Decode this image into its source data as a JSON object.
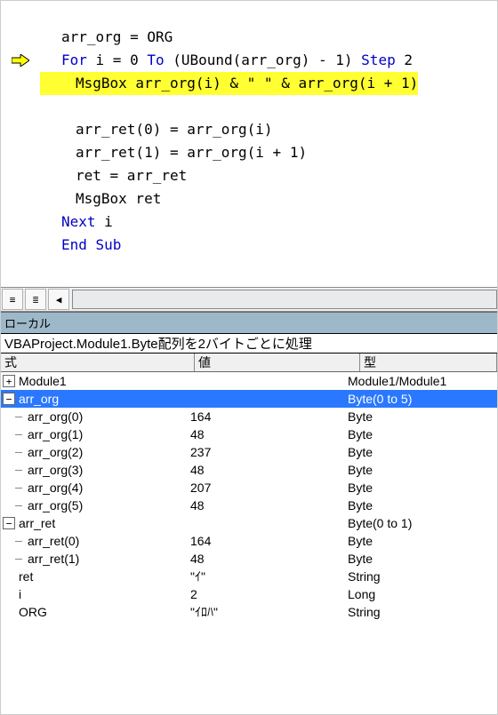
{
  "code": {
    "l1": "arr_org = ORG",
    "l2a": "For",
    "l2b": " i = 0 ",
    "l2c": "To",
    "l2d": " (UBound(arr_org) - 1) ",
    "l2e": "Step",
    "l2f": " 2",
    "l3": "MsgBox arr_org(i) & \" \" & arr_org(i + 1)",
    "l4": "",
    "l5": "arr_ret(0) = arr_org(i)",
    "l6": "arr_ret(1) = arr_org(i + 1)",
    "l7": "ret = arr_ret",
    "l8": "MsgBox ret",
    "l9a": "Next",
    "l9b": " i",
    "l10": "End Sub"
  },
  "toolbar": {
    "btn1": "≡",
    "btn2": "≣",
    "btn3": "◀"
  },
  "panel": {
    "title": "ローカル",
    "context": "VBAProject.Module1.Byte配列を2バイトごとに処理",
    "headers": {
      "c1": "式",
      "c2": "値",
      "c3": "型"
    },
    "rows": [
      {
        "toggle": "plus",
        "depth": 0,
        "name": "Module1",
        "value": "",
        "type": "Module1/Module1",
        "sel": false
      },
      {
        "toggle": "minus",
        "depth": 0,
        "name": "arr_org",
        "value": "",
        "type": "Byte(0 to 5)",
        "sel": true
      },
      {
        "toggle": "",
        "depth": 1,
        "name": "arr_org(0)",
        "value": "164",
        "type": "Byte",
        "branch": "mid"
      },
      {
        "toggle": "",
        "depth": 1,
        "name": "arr_org(1)",
        "value": "48",
        "type": "Byte",
        "branch": "mid"
      },
      {
        "toggle": "",
        "depth": 1,
        "name": "arr_org(2)",
        "value": "237",
        "type": "Byte",
        "branch": "mid"
      },
      {
        "toggle": "",
        "depth": 1,
        "name": "arr_org(3)",
        "value": "48",
        "type": "Byte",
        "branch": "mid"
      },
      {
        "toggle": "",
        "depth": 1,
        "name": "arr_org(4)",
        "value": "207",
        "type": "Byte",
        "branch": "mid"
      },
      {
        "toggle": "",
        "depth": 1,
        "name": "arr_org(5)",
        "value": "48",
        "type": "Byte",
        "branch": "last"
      },
      {
        "toggle": "minus",
        "depth": 0,
        "name": "arr_ret",
        "value": "",
        "type": "Byte(0 to 1)",
        "sel": false
      },
      {
        "toggle": "",
        "depth": 1,
        "name": "arr_ret(0)",
        "value": "164",
        "type": "Byte",
        "branch": "mid"
      },
      {
        "toggle": "",
        "depth": 1,
        "name": "arr_ret(1)",
        "value": "48",
        "type": "Byte",
        "branch": "last"
      },
      {
        "toggle": "",
        "depth": 0,
        "name": "ret",
        "value": "\"ｲ\"",
        "type": "String"
      },
      {
        "toggle": "",
        "depth": 0,
        "name": "i",
        "value": "2",
        "type": "Long"
      },
      {
        "toggle": "",
        "depth": 0,
        "name": "ORG",
        "value": "\"ｲﾛﾊ\"",
        "type": "String"
      }
    ]
  }
}
